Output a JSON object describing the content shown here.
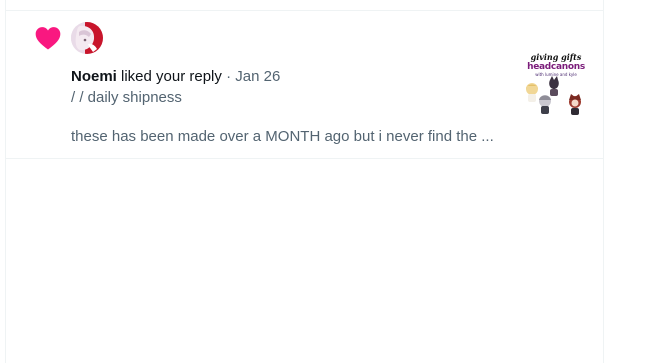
{
  "notification": {
    "user_name": "Noemi",
    "action": "liked your reply",
    "separator": "·",
    "date": "Jan 26",
    "context": "/ / daily shipness",
    "snippet": "these has been made over a MONTH ago but i never find the ...",
    "thumbnail": {
      "title": "giving gifts",
      "subtitle": "headcanons",
      "small_caption": "with lumine and kyle"
    }
  },
  "icons": {
    "like": "heart-icon",
    "avatar": "user-avatar"
  },
  "colors": {
    "heart": "#f91880",
    "text_primary": "#0f1419",
    "text_secondary": "#536471",
    "divider": "#eff3f4",
    "thumbnail_subtitle": "#7b1c7a"
  }
}
